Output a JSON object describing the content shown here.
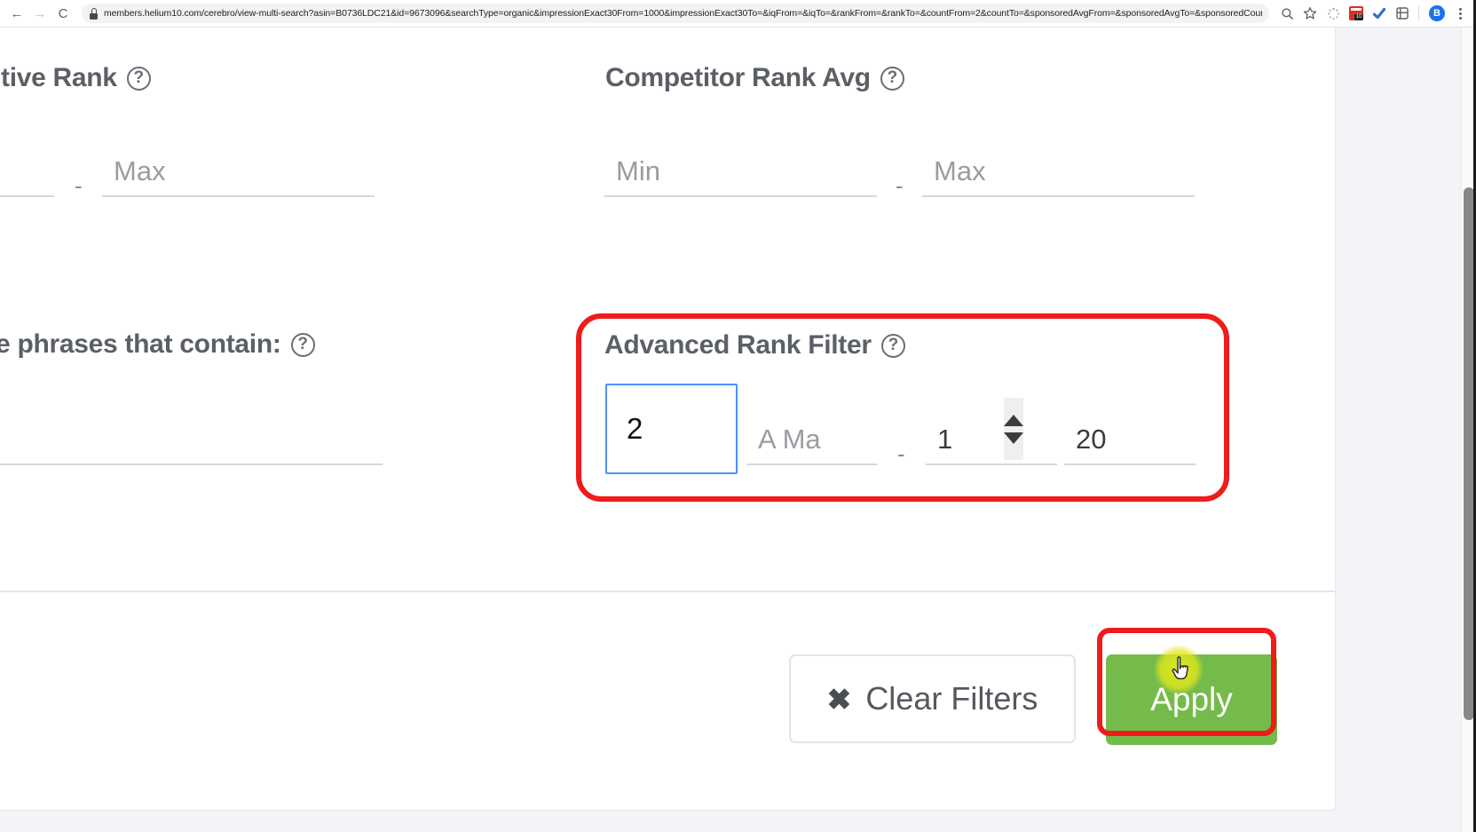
{
  "browser": {
    "back_icon": "back-arrow-icon",
    "forward_icon": "forward-arrow-icon",
    "reload_label": "C",
    "url": "members.helium10.com/cerebro/view-multi-search?asin=B0736LDC21&id=9673096&searchType=organic&impressionExact30From=1000&impressionExact30To=&iqFrom=&iqTo=&rankFrom=&rankTo=&countFrom=2&countTo=&sponsoredAvgFrom=&sponsoredAvgTo=&sponsoredCountF...",
    "lock_icon": "lock-icon",
    "toolbar_icons": [
      {
        "name": "search-page-icon",
        "glyph": "⌕"
      },
      {
        "name": "bookmark-star-icon",
        "glyph": "☆"
      },
      {
        "name": "loading-spinner-icon",
        "glyph": "◌"
      },
      {
        "name": "helium10-extension-icon",
        "badge": "10"
      },
      {
        "name": "grammarly-extension-icon",
        "glyph": "✔"
      },
      {
        "name": "extensions-puzzle-icon",
        "glyph": "⊞"
      }
    ],
    "profile_initial": "B",
    "menu_icon": "kebab-menu-icon"
  },
  "filters": {
    "relative_rank": {
      "label": "tive Rank",
      "help_icon": "help-circle-icon",
      "min_value": "",
      "min_placeholder": "",
      "separator": "-",
      "max_value": "",
      "max_placeholder": "Max"
    },
    "competitor_rank_avg": {
      "label": "Competitor Rank Avg",
      "help_icon": "help-circle-icon",
      "min_value": "",
      "min_placeholder": "Min",
      "separator": "-",
      "max_value": "",
      "max_placeholder": "Max"
    },
    "exclude_phrases": {
      "label": "ude phrases that contain:",
      "help_icon": "help-circle-icon",
      "value": "",
      "placeholder": ""
    },
    "advanced_rank_filter": {
      "label": "Advanced Rank Filter",
      "help_icon": "help-circle-icon",
      "count_value": "2",
      "spinner_up_icon": "spinner-up-arrow-icon",
      "spinner_down_icon": "spinner-down-arrow-icon",
      "position_value": "",
      "position_placeholder": "A Ma",
      "separator": "-",
      "range_from_value": "1",
      "range_to_value": "20"
    }
  },
  "actions": {
    "clear_filters_label": "Clear Filters",
    "clear_filters_icon": "x-close-icon",
    "apply_label": "Apply"
  },
  "annotations": {
    "highlight_color": "#ee1c1c",
    "cursor_highlight_color": "#e2e819",
    "apply_button_color": "#75bb4c"
  }
}
